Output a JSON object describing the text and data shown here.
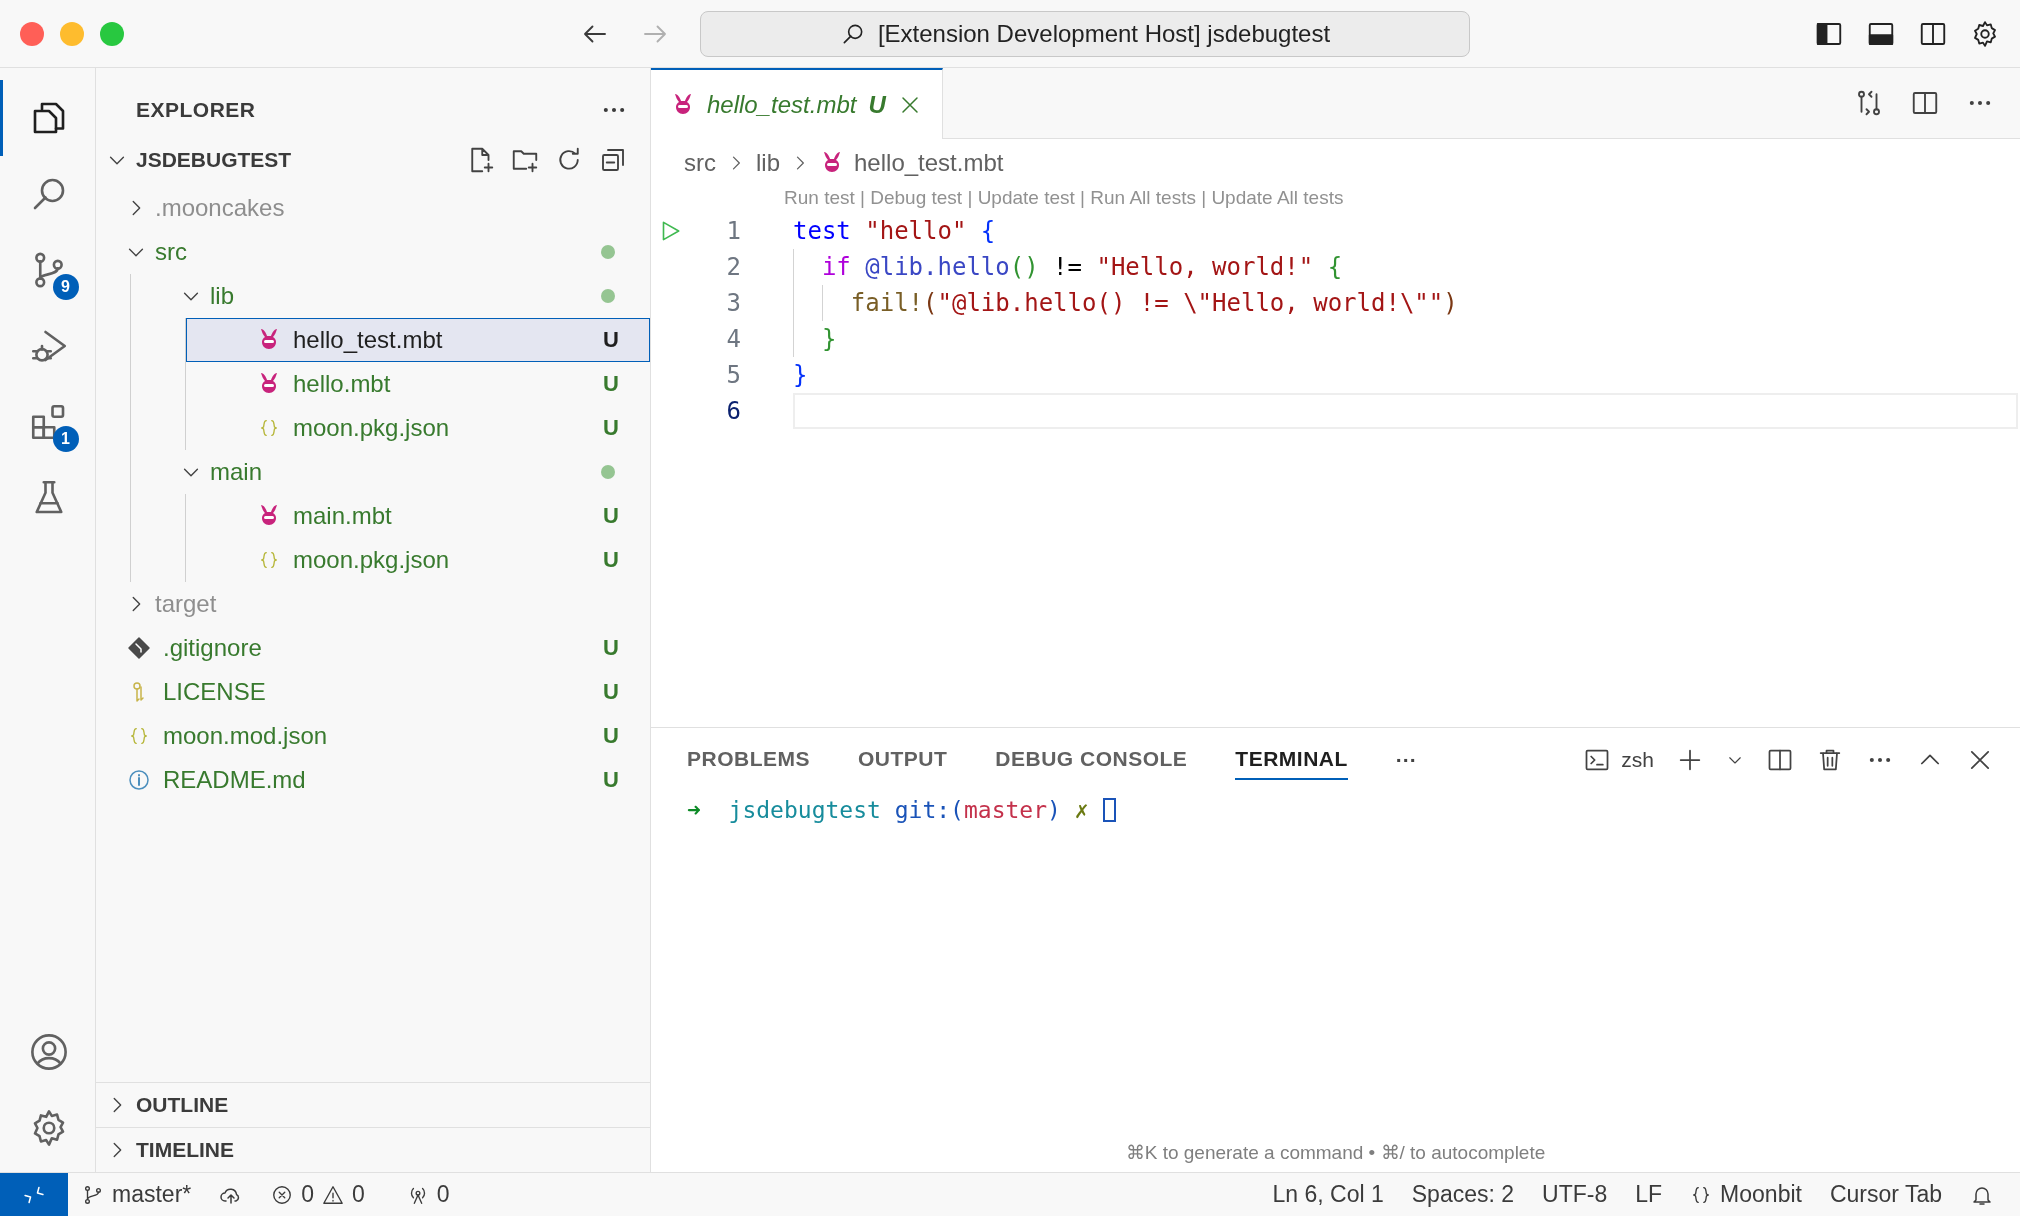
{
  "window": {
    "title": "[Extension Development Host] jsdebugtest"
  },
  "activity_bar": {
    "items": [
      {
        "kind": "explorer",
        "selected": true
      },
      {
        "kind": "search",
        "selected": false
      },
      {
        "kind": "source-control",
        "selected": false,
        "badge": "9"
      },
      {
        "kind": "run-debug",
        "selected": false
      },
      {
        "kind": "extensions",
        "selected": false,
        "badge": "1"
      },
      {
        "kind": "testing",
        "selected": false
      }
    ],
    "bottom": [
      {
        "kind": "account"
      },
      {
        "kind": "settings"
      }
    ]
  },
  "explorer": {
    "title": "EXPLORER",
    "root": {
      "label": "JSDEBUGTEST",
      "expanded": true
    },
    "tree": [
      {
        "label": ".mooncakes",
        "kind": "folder",
        "ignored": true,
        "expanded": false,
        "dot": false
      },
      {
        "label": "src",
        "kind": "folder",
        "ignored": false,
        "expanded": true,
        "dot": true,
        "children": [
          {
            "label": "lib",
            "kind": "folder",
            "ignored": false,
            "expanded": true,
            "dot": true,
            "children": [
              {
                "label": "hello_test.mbt",
                "kind": "mbt",
                "ignored": false,
                "badge": "U",
                "selected": true
              },
              {
                "label": "hello.mbt",
                "kind": "mbt",
                "ignored": false,
                "badge": "U",
                "selected": false
              },
              {
                "label": "moon.pkg.json",
                "kind": "json",
                "ignored": false,
                "badge": "U",
                "selected": false
              }
            ]
          },
          {
            "label": "main",
            "kind": "folder",
            "ignored": false,
            "expanded": true,
            "dot": true,
            "children": [
              {
                "label": "main.mbt",
                "kind": "mbt",
                "ignored": false,
                "badge": "U",
                "selected": false
              },
              {
                "label": "moon.pkg.json",
                "kind": "json",
                "ignored": false,
                "badge": "U",
                "selected": false
              }
            ]
          }
        ]
      },
      {
        "label": "target",
        "kind": "folder",
        "ignored": true,
        "expanded": false,
        "dot": false
      },
      {
        "label": ".gitignore",
        "kind": "git",
        "ignored": false,
        "badge": "U",
        "selected": false
      },
      {
        "label": "LICENSE",
        "kind": "license",
        "ignored": false,
        "badge": "U",
        "selected": false
      },
      {
        "label": "moon.mod.json",
        "kind": "json",
        "ignored": false,
        "badge": "U",
        "selected": false
      },
      {
        "label": "README.md",
        "kind": "info",
        "ignored": false,
        "badge": "U",
        "selected": false
      }
    ],
    "sections": [
      {
        "label": "OUTLINE",
        "expanded": false
      },
      {
        "label": "TIMELINE",
        "expanded": false
      }
    ]
  },
  "editor": {
    "tabs": [
      {
        "label": "hello_test.mbt",
        "badge": "U",
        "selected": true
      }
    ],
    "breadcrumbs": [
      {
        "label": "src",
        "kind": "folder"
      },
      {
        "label": "lib",
        "kind": "folder"
      },
      {
        "label": "hello_test.mbt",
        "kind": "mbt"
      }
    ],
    "codelens": "Run test | Debug test | Update test | Run All tests | Update All tests",
    "lines": [
      {
        "number": "1",
        "run": true,
        "current": false,
        "tokens": [
          {
            "t": "test ",
            "color": "#0000ff"
          },
          {
            "t": "\"hello\" ",
            "color": "#a31515"
          },
          {
            "t": "{",
            "color": "#0431fa"
          }
        ]
      },
      {
        "number": "2",
        "run": false,
        "current": false,
        "tokens": [
          {
            "t": "  if ",
            "color": "#af00db"
          },
          {
            "t": "@lib.hello",
            "color": "#3a47c4"
          },
          {
            "t": "()",
            "color": "#319331"
          },
          {
            "t": " != ",
            "color": "#000000"
          },
          {
            "t": "\"Hello, world!\" ",
            "color": "#a31515"
          },
          {
            "t": "{",
            "color": "#319331"
          }
        ]
      },
      {
        "number": "3",
        "run": false,
        "current": false,
        "tokens": [
          {
            "t": "    fail!",
            "color": "#795e26"
          },
          {
            "t": "(",
            "color": "#7b3814"
          },
          {
            "t": "\"@lib.hello() != \\\"Hello, world!\\\"\"",
            "color": "#a31515"
          },
          {
            "t": ")",
            "color": "#7b3814"
          }
        ]
      },
      {
        "number": "4",
        "run": false,
        "current": false,
        "tokens": [
          {
            "t": "  }",
            "color": "#319331"
          }
        ]
      },
      {
        "number": "5",
        "run": false,
        "current": false,
        "tokens": [
          {
            "t": "}",
            "color": "#0431fa"
          }
        ]
      },
      {
        "number": "6",
        "run": false,
        "current": true
      }
    ]
  },
  "panel": {
    "tabs": [
      {
        "label": "PROBLEMS",
        "selected": false
      },
      {
        "label": "OUTPUT",
        "selected": false
      },
      {
        "label": "DEBUG CONSOLE",
        "selected": false
      },
      {
        "label": "TERMINAL",
        "selected": true
      }
    ],
    "more": "···",
    "shell": "zsh",
    "terminal": [
      {
        "t": "➜",
        "color": "#0c8a26"
      },
      {
        "t": "  jsdebugtest",
        "color": "#178c9c"
      },
      {
        "t": " git:(",
        "color": "#1a53b8"
      },
      {
        "t": "master",
        "color": "#c4314b"
      },
      {
        "t": ")",
        "color": "#1a53b8"
      },
      {
        "t": " ✗",
        "color": "#6b7a12"
      }
    ],
    "hint": "⌘K to generate a command • ⌘/ to autocomplete"
  },
  "status_bar": {
    "left": [
      {
        "kind": "branch",
        "text": "master*"
      },
      {
        "kind": "sync"
      },
      {
        "kind": "problems",
        "errors": "0",
        "warnings": "0"
      },
      {
        "kind": "ports",
        "text": "0"
      }
    ],
    "right": [
      {
        "kind": "text",
        "text": "Ln 6, Col 1"
      },
      {
        "kind": "text",
        "text": "Spaces: 2"
      },
      {
        "kind": "text",
        "text": "UTF-8"
      },
      {
        "kind": "text",
        "text": "LF"
      },
      {
        "kind": "language",
        "text": "Moonbit"
      },
      {
        "kind": "text",
        "text": "Cursor Tab"
      },
      {
        "kind": "bell"
      }
    ]
  }
}
